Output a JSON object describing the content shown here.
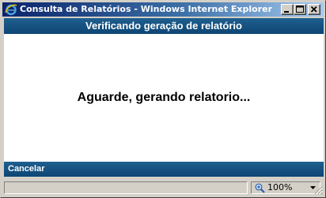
{
  "window": {
    "title": "Consulta de Relatórios - Windows Internet Explorer forn..."
  },
  "header": {
    "title": "Verificando geração de relatório"
  },
  "main": {
    "message": "Aguarde, gerando relatorio..."
  },
  "footer": {
    "cancel_label": "Cancelar"
  },
  "statusbar": {
    "zoom_label": "100%"
  },
  "colors": {
    "title_gradient_start": "#0a246a",
    "title_gradient_end": "#a6caf0",
    "header_bar": "#15517f",
    "window_face": "#d4d0c8"
  },
  "icons": [
    "ie-icon",
    "minimize-icon",
    "maximize-icon",
    "close-icon",
    "zoom-icon",
    "chevron-down-icon",
    "resize-grip-icon"
  ]
}
